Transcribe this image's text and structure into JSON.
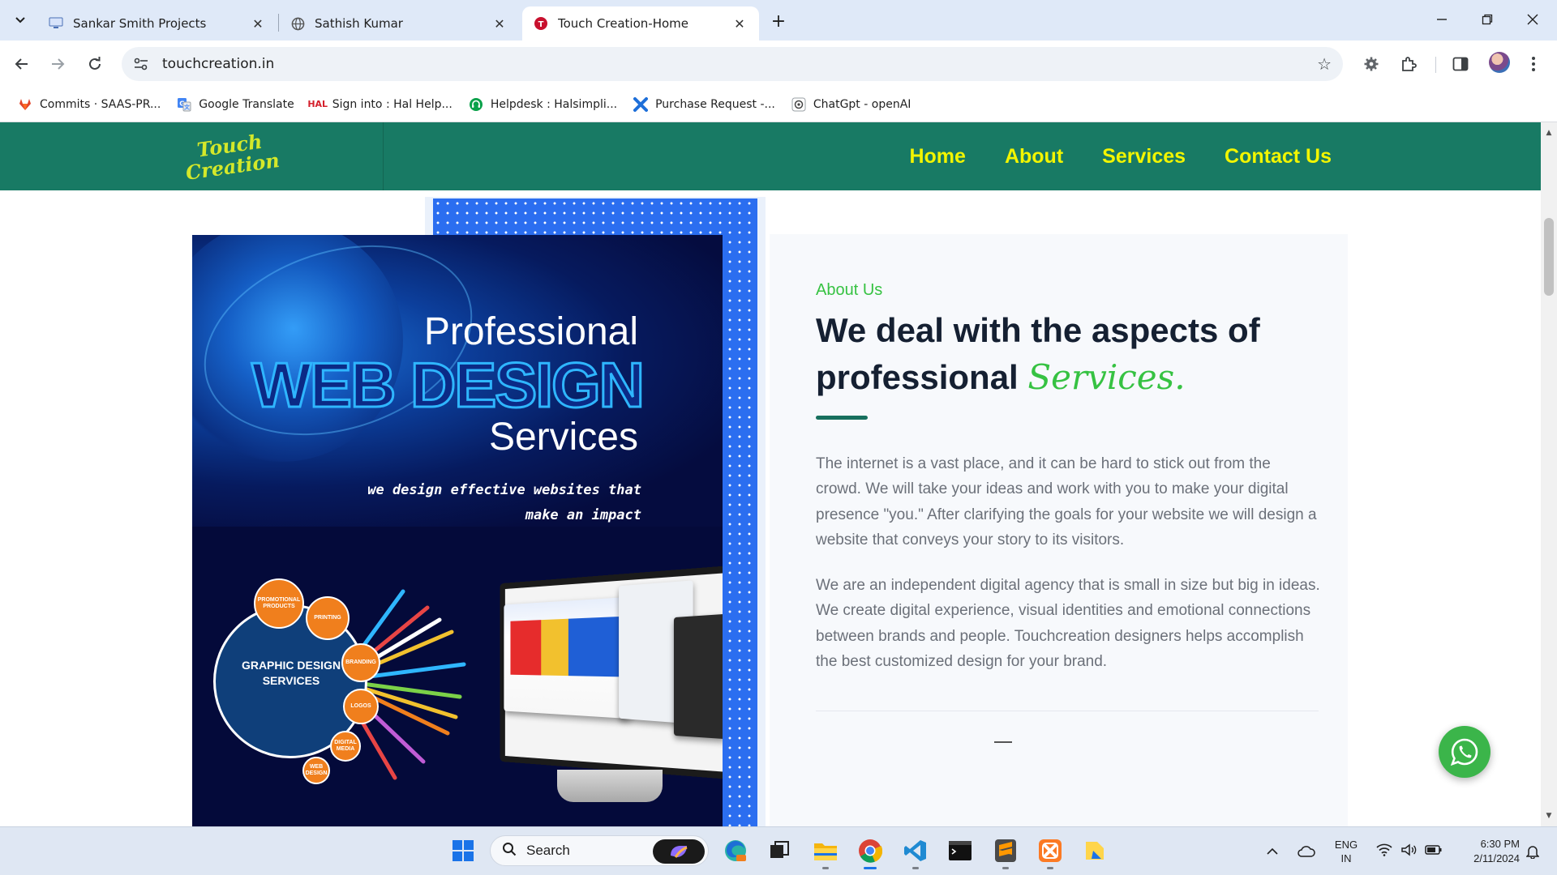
{
  "browser": {
    "tabs": [
      {
        "title": "Sankar Smith Projects",
        "icon": "monitor-icon",
        "active": false
      },
      {
        "title": "Sathish Kumar",
        "icon": "globe-icon",
        "active": false
      },
      {
        "title": "Touch Creation-Home",
        "icon": "touch-creation-favicon",
        "active": true
      }
    ],
    "url": "touchcreation.in",
    "bookmarks": [
      {
        "label": "Commits · SAAS-PR...",
        "icon": "gitlab-icon",
        "color": "#e24329"
      },
      {
        "label": "Google Translate",
        "icon": "translate-icon",
        "color": "#4285f4"
      },
      {
        "label": "Sign into : Hal Help...",
        "icon": "hal-icon",
        "color": "#d4202c"
      },
      {
        "label": "Helpdesk : Halsimpli...",
        "icon": "helpdesk-icon",
        "color": "#0aa14a"
      },
      {
        "label": "Purchase Request -...",
        "icon": "x-shape-icon",
        "color": "#1e6fd9"
      },
      {
        "label": "ChatGpt - openAI",
        "icon": "chatgpt-icon",
        "color": "#444444"
      }
    ]
  },
  "site": {
    "logo_text": [
      "Touch",
      "Creation"
    ],
    "nav": [
      "Home",
      "About",
      "Services",
      "Contact Us"
    ],
    "colors": {
      "header": "#187a64",
      "nav_text": "#f2f500",
      "accent_green": "#36c242",
      "dots_blue": "#2b6ef0"
    },
    "hero": {
      "line1": "Professional",
      "line2": "WEB DESIGN",
      "line3": "Services",
      "tagline": "we design effective websites that make an impact",
      "graphic_label": "GRAPHIC DESIGN SERVICES",
      "orbs": [
        "PROMOTIONAL PRODUCTS",
        "PRINTING",
        "BRANDING",
        "LOGOS",
        "DIGITAL MEDIA",
        "WEB DESIGN"
      ]
    },
    "about": {
      "kicker": "About Us",
      "title_plain": "We deal with the aspects of professional",
      "title_accent": "Services.",
      "para1": "The internet is a vast place, and it can be hard to stick out from the crowd. We will take your ideas and work with you to make your digital presence \"you.\" After clarifying the goals for your website we will design a website that conveys your story to its visitors.",
      "para2": "We are an independent digital agency that is small in size but big in ideas. We create digital experience, visual identities and emotional connections between brands and people. Touchcreation designers helps accomplish the best customized design for your brand."
    }
  },
  "taskbar": {
    "search_label": "Search",
    "apps": [
      "windows-start-icon",
      "copilot-icon",
      "edge-icon",
      "task-view-icon",
      "file-explorer-icon",
      "chrome-icon",
      "vscode-icon",
      "terminal-icon",
      "sublime-text-icon",
      "xampp-icon",
      "notes-icon"
    ],
    "lang_line1": "ENG",
    "lang_line2": "IN",
    "time": "6:30 PM",
    "date": "2/11/2024"
  }
}
